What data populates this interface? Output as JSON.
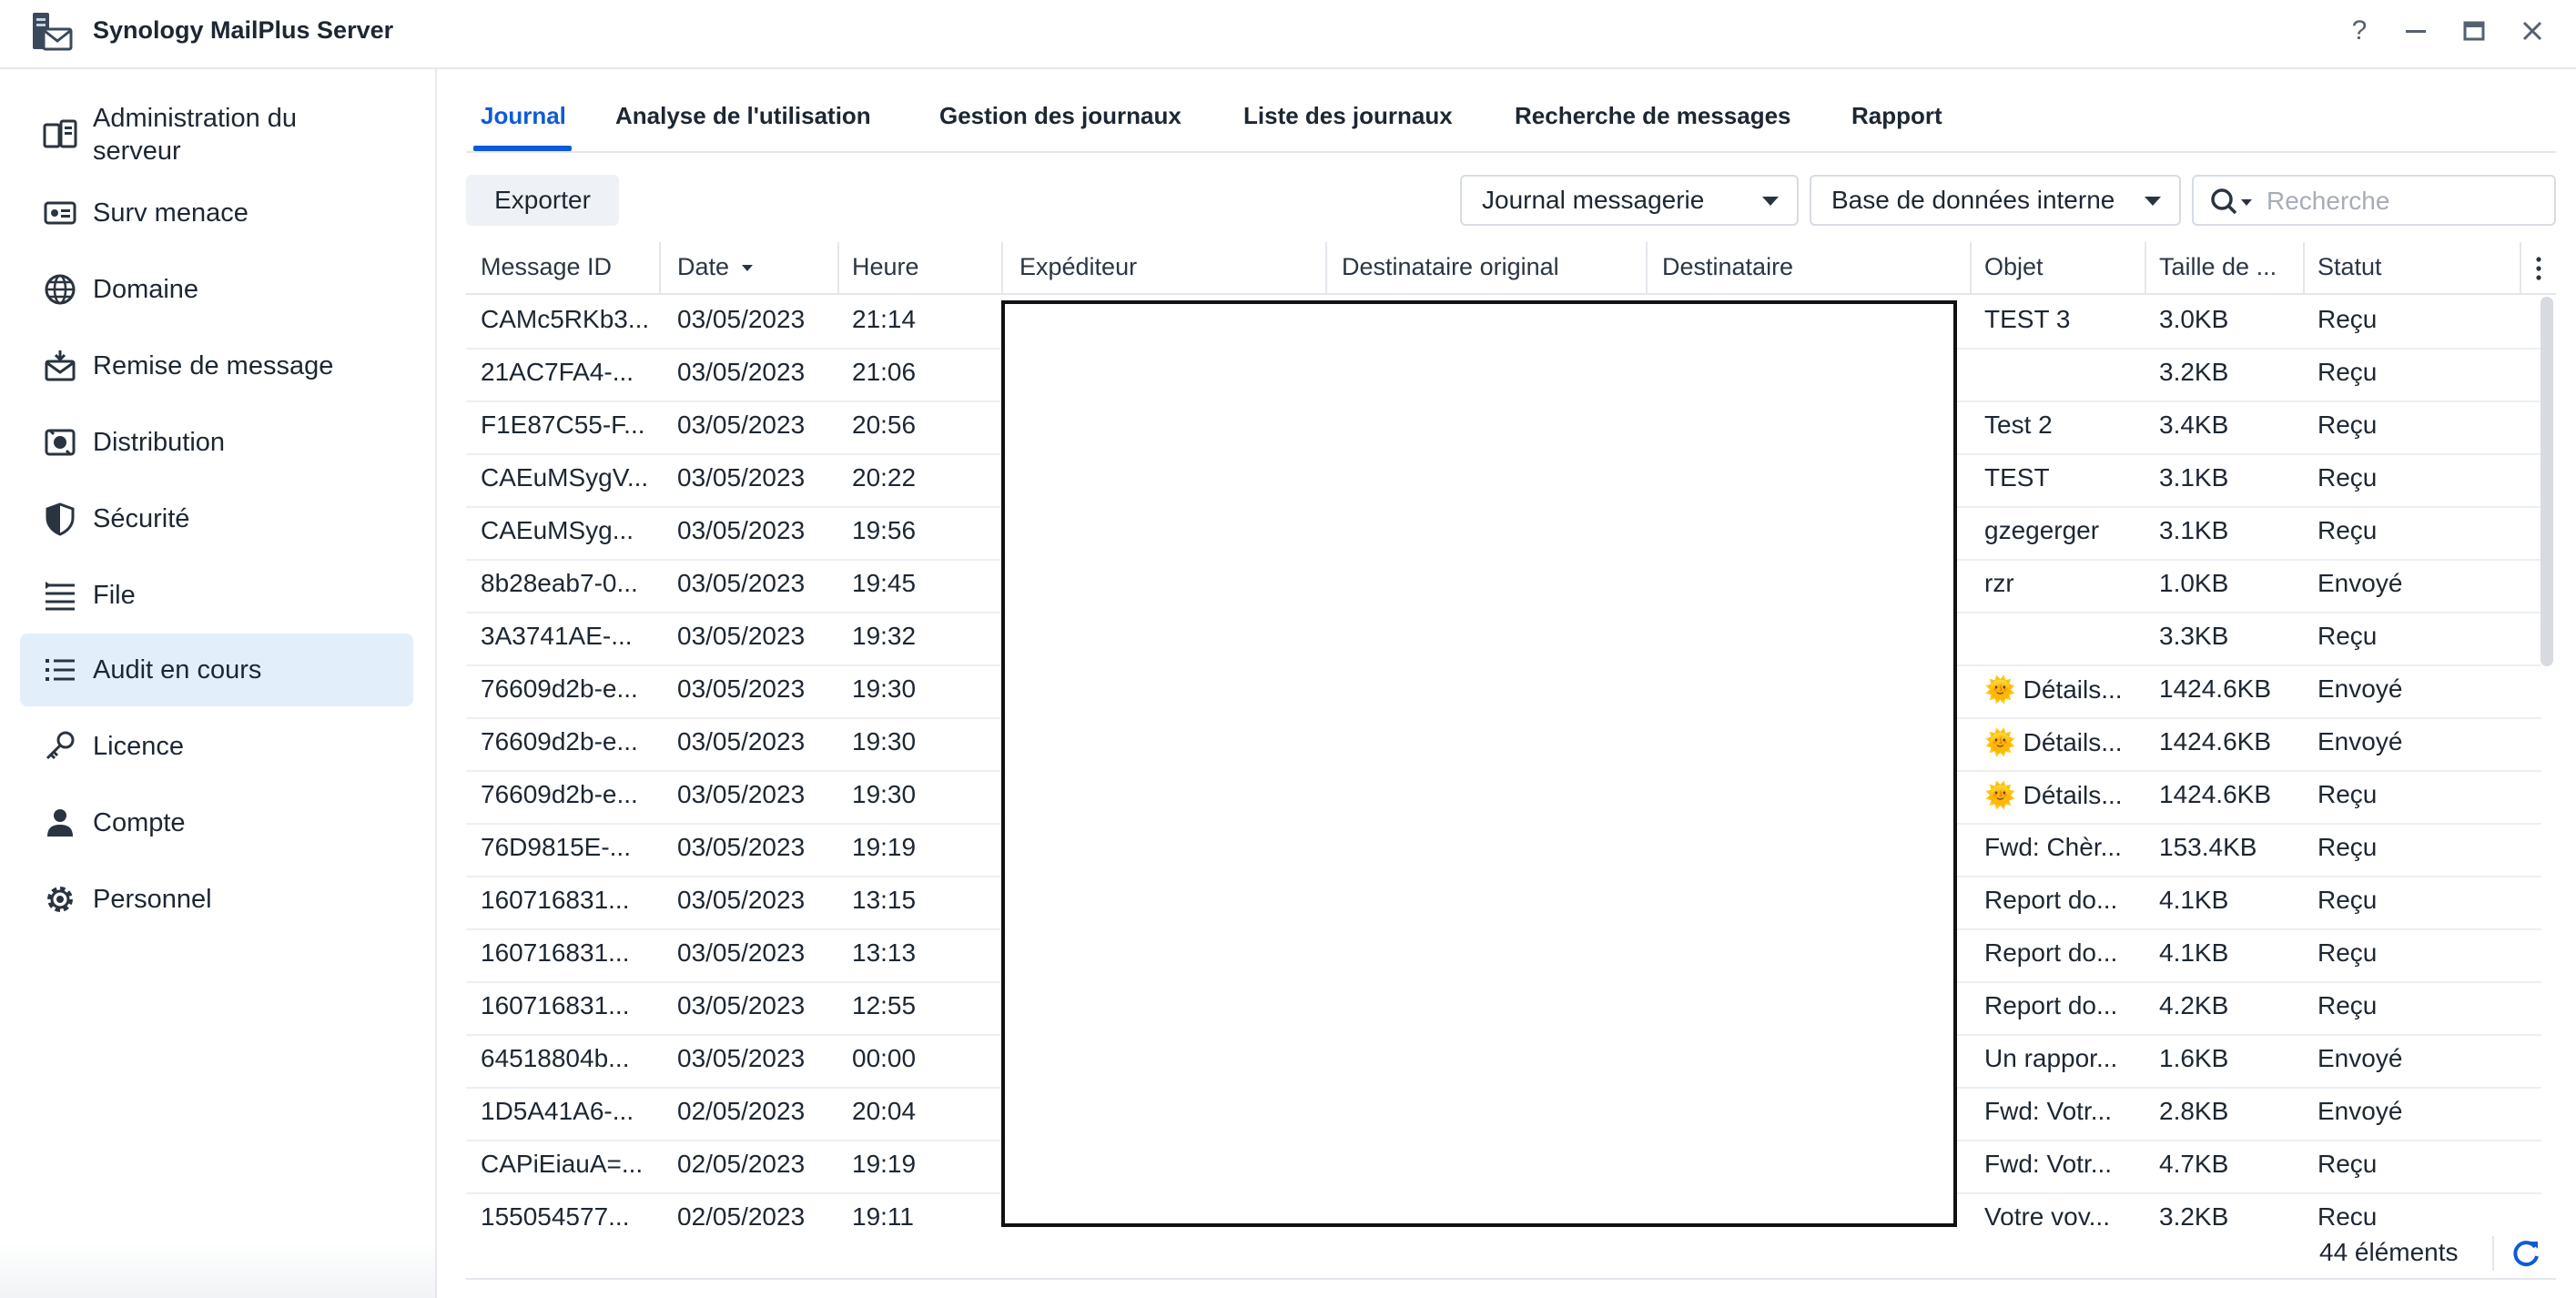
{
  "window": {
    "title": "Synology MailPlus Server",
    "controls": {
      "help": "?",
      "minimize": "—",
      "maximize": "▭",
      "close": "✕"
    }
  },
  "sidebar": {
    "items": [
      {
        "label": "Administration du serveur",
        "icon": "server-admin-icon",
        "active": false
      },
      {
        "label": "Surv menace",
        "icon": "threat-monitor-icon",
        "active": false
      },
      {
        "label": "Domaine",
        "icon": "globe-icon",
        "active": false
      },
      {
        "label": "Remise de message",
        "icon": "mail-delivery-icon",
        "active": false
      },
      {
        "label": "Distribution",
        "icon": "distribution-icon",
        "active": false
      },
      {
        "label": "Sécurité",
        "icon": "shield-icon",
        "active": false
      },
      {
        "label": "File",
        "icon": "queue-icon",
        "active": false
      },
      {
        "label": "Audit en cours",
        "icon": "list-icon",
        "active": true
      },
      {
        "label": "Licence",
        "icon": "key-icon",
        "active": false
      },
      {
        "label": "Compte",
        "icon": "user-icon",
        "active": false
      },
      {
        "label": "Personnel",
        "icon": "gear-icon",
        "active": false
      }
    ]
  },
  "tabs": [
    {
      "label": "Journal",
      "active": true
    },
    {
      "label": "Analyse de l'utilisation",
      "active": false
    },
    {
      "label": "Gestion des journaux",
      "active": false
    },
    {
      "label": "Liste des journaux",
      "active": false
    },
    {
      "label": "Recherche de messages",
      "active": false
    },
    {
      "label": "Rapport",
      "active": false
    }
  ],
  "toolbar": {
    "export_label": "Exporter",
    "log_type_select": "Journal messagerie",
    "database_select": "Base de données interne",
    "search_placeholder": "Recherche"
  },
  "table": {
    "columns": [
      "Message ID",
      "Date",
      "Heure",
      "Expéditeur",
      "Destinataire original",
      "Destinataire",
      "Objet",
      "Taille de ...",
      "Statut"
    ],
    "sorted_column": "Date",
    "rows": [
      {
        "id": "CAMc5RKb3...",
        "date": "03/05/2023",
        "time": "21:14",
        "subject": "TEST 3",
        "size": "3.0KB",
        "status": "Reçu"
      },
      {
        "id": "21AC7FA4-...",
        "date": "03/05/2023",
        "time": "21:06",
        "subject": "",
        "size": "3.2KB",
        "status": "Reçu"
      },
      {
        "id": "F1E87C55-F...",
        "date": "03/05/2023",
        "time": "20:56",
        "subject": "Test 2",
        "size": "3.4KB",
        "status": "Reçu"
      },
      {
        "id": "CAEuMSygV...",
        "date": "03/05/2023",
        "time": "20:22",
        "subject": "TEST",
        "size": "3.1KB",
        "status": "Reçu"
      },
      {
        "id": "CAEuMSyg...",
        "date": "03/05/2023",
        "time": "19:56",
        "subject": "gzegerger",
        "size": "3.1KB",
        "status": "Reçu"
      },
      {
        "id": "8b28eab7-0...",
        "date": "03/05/2023",
        "time": "19:45",
        "subject": "rzr",
        "size": "1.0KB",
        "status": "Envoyé"
      },
      {
        "id": "3A3741AE-...",
        "date": "03/05/2023",
        "time": "19:32",
        "subject": "",
        "size": "3.3KB",
        "status": "Reçu"
      },
      {
        "id": "76609d2b-e...",
        "date": "03/05/2023",
        "time": "19:30",
        "subject": "🌞 Détails...",
        "size": "1424.6KB",
        "status": "Envoyé"
      },
      {
        "id": "76609d2b-e...",
        "date": "03/05/2023",
        "time": "19:30",
        "subject": "🌞 Détails...",
        "size": "1424.6KB",
        "status": "Envoyé"
      },
      {
        "id": "76609d2b-e...",
        "date": "03/05/2023",
        "time": "19:30",
        "subject": "🌞 Détails...",
        "size": "1424.6KB",
        "status": "Reçu"
      },
      {
        "id": "76D9815E-...",
        "date": "03/05/2023",
        "time": "19:19",
        "subject": "Fwd: Chèr...",
        "size": "153.4KB",
        "status": "Reçu"
      },
      {
        "id": "160716831...",
        "date": "03/05/2023",
        "time": "13:15",
        "subject": "Report do...",
        "size": "4.1KB",
        "status": "Reçu"
      },
      {
        "id": "160716831...",
        "date": "03/05/2023",
        "time": "13:13",
        "subject": "Report do...",
        "size": "4.1KB",
        "status": "Reçu"
      },
      {
        "id": "160716831...",
        "date": "03/05/2023",
        "time": "12:55",
        "subject": "Report do...",
        "size": "4.2KB",
        "status": "Reçu"
      },
      {
        "id": "64518804b...",
        "date": "03/05/2023",
        "time": "00:00",
        "subject": "Un rappor...",
        "size": "1.6KB",
        "status": "Envoyé"
      },
      {
        "id": "1D5A41A6-...",
        "date": "02/05/2023",
        "time": "20:04",
        "subject": "Fwd: Votr...",
        "size": "2.8KB",
        "status": "Envoyé"
      },
      {
        "id": "CAPiEiauA=...",
        "date": "02/05/2023",
        "time": "19:19",
        "subject": "Fwd: Votr...",
        "size": "4.7KB",
        "status": "Reçu"
      },
      {
        "id": "155054577...",
        "date": "02/05/2023",
        "time": "19:11",
        "subject": "Votre voy...",
        "size": "3.2KB",
        "status": "Reçu"
      }
    ]
  },
  "footer": {
    "count_label": "44 éléments"
  },
  "colors": {
    "accent": "#0f5bd6",
    "active_bg": "#e2effb",
    "border": "#e3e7ed"
  }
}
